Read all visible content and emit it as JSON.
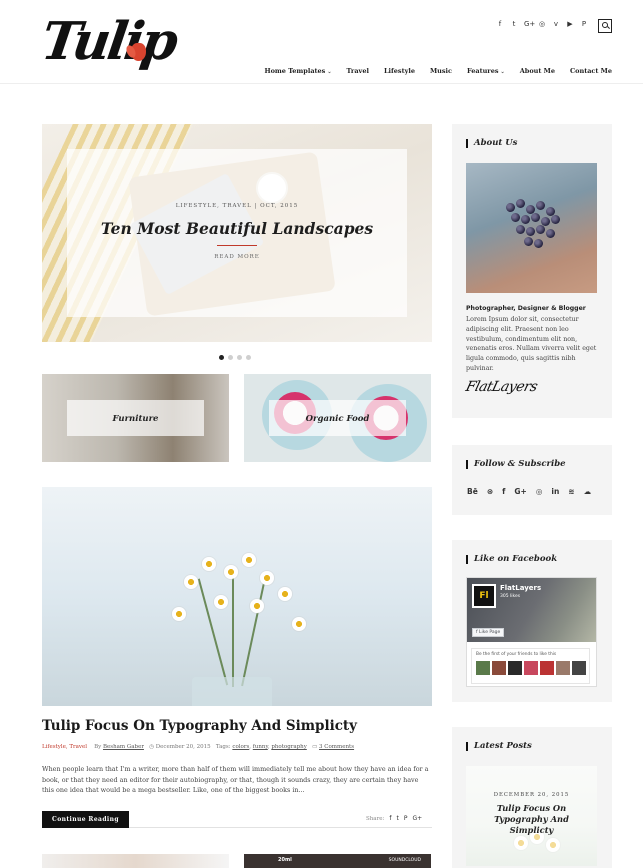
{
  "header": {
    "logo_text": "Tulip",
    "social_icons": [
      "f",
      "t",
      "G+",
      "◎",
      "v",
      "▶",
      "P"
    ],
    "social_icon_names": [
      "facebook-icon",
      "twitter-icon",
      "google-plus-icon",
      "instagram-icon",
      "vimeo-icon",
      "youtube-icon",
      "pinterest-icon"
    ],
    "nav": [
      {
        "label": "Home Templates",
        "has_dropdown": true
      },
      {
        "label": "Travel",
        "has_dropdown": false
      },
      {
        "label": "Lifestyle",
        "has_dropdown": false
      },
      {
        "label": "Music",
        "has_dropdown": false
      },
      {
        "label": "Features",
        "has_dropdown": true
      },
      {
        "label": "About Me",
        "has_dropdown": false
      },
      {
        "label": "Contact Me",
        "has_dropdown": false
      }
    ]
  },
  "slider": {
    "meta": "LIFESTYLE, TRAVEL | OCT, 2015",
    "title": "Ten Most Beautiful Landscapes",
    "read_more": "READ MORE",
    "slide_count": 4,
    "active_slide": 1
  },
  "categories": [
    {
      "label": "Furniture"
    },
    {
      "label": "Organic Food"
    }
  ],
  "post": {
    "title": "Tulip Focus On Typography And Simplicty",
    "categories": "Lifestyle, Travel",
    "by_label": "By",
    "author": "Besham Gaber",
    "date": "December 20, 2015",
    "tags_label": "Tags:",
    "tags": [
      "colors",
      "funny",
      "photography"
    ],
    "comments": "3 Comments",
    "excerpt": "When people learn that I'm a writer, more than half of them will immediately tell me about how they have an idea for a book, or that they need an editor for their autobiography, or that, though it sounds crazy, they are certain they have this one idea that would be a mega bestseller. Like, one of the biggest books in...",
    "read_button": "Continue Reading",
    "share_label": "Share:",
    "share_icons": [
      "f",
      "t",
      "P",
      "G+"
    ]
  },
  "next_posts": {
    "right_tag": "20ml",
    "right_source": "SOUNDCLOUD"
  },
  "sidebar": {
    "about": {
      "title": "About Us",
      "heading": "Photographer, Designer & Blogger",
      "text": "Lorem Ipsum dolor sit, consectetur adipiscing elit. Praesent non leo vestibulum, condimentum elit non, venenatis eros. Nullam viverra velit eget ligula commodo, quis sagittis nibh pulvinar.",
      "signature": "FlatLayers"
    },
    "follow": {
      "title": "Follow & Subscribe",
      "icons": [
        "Bē",
        "⊛",
        "f",
        "G+",
        "◎",
        "in",
        "≋",
        "☁"
      ],
      "icon_names": [
        "behance-icon",
        "dribbble-icon",
        "facebook-icon",
        "google-plus-icon",
        "instagram-icon",
        "linkedin-icon",
        "rss-icon",
        "soundcloud-icon"
      ]
    },
    "facebook": {
      "title": "Like on Facebook",
      "page_name": "FlatLayers",
      "likes": "305 likes",
      "like_button": "Like Page",
      "friends_text": "Be the first of your friends to like this",
      "logo": "Fl"
    },
    "latest": {
      "title": "Latest Posts",
      "date": "DECEMBER 20, 2015",
      "post_title": "Tulip Focus On Typography And Simplicty"
    }
  },
  "colors": {
    "accent": "#c0392b",
    "dark": "#111111",
    "widget_bg": "#f4f4f4"
  }
}
